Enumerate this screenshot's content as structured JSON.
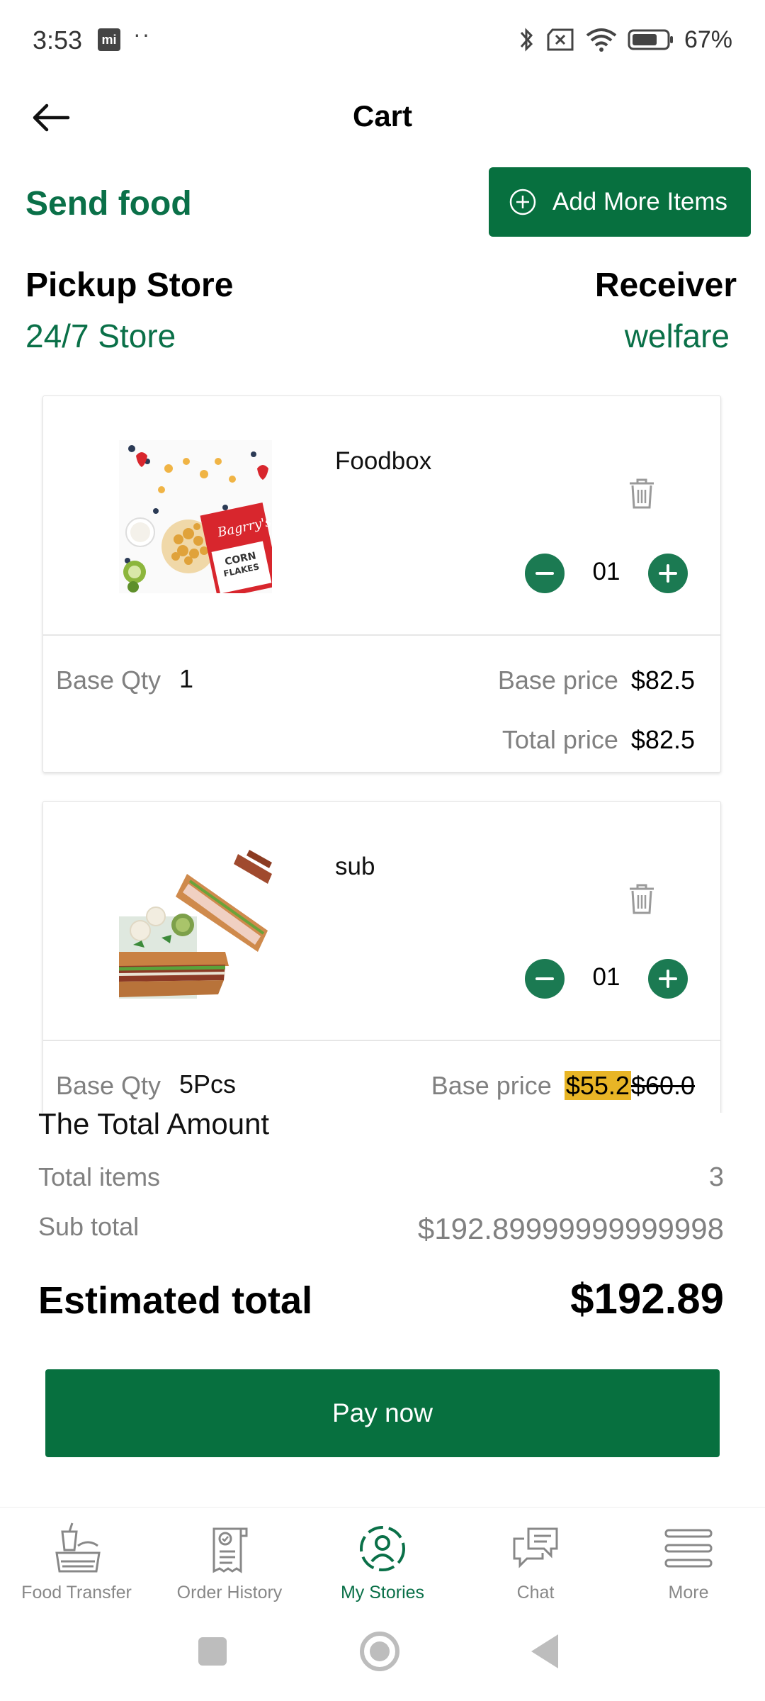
{
  "status_bar": {
    "time": "3:53",
    "mi_badge": "mi",
    "dots": "··",
    "battery": "67%",
    "icons": [
      "bluetooth-icon",
      "no-sim-icon",
      "wifi-icon",
      "battery-icon"
    ]
  },
  "app_bar": {
    "title": "Cart",
    "back_icon": "back-arrow-icon"
  },
  "send_food": {
    "title": "Send food",
    "add_more_label": "Add More Items",
    "add_more_icon": "plus-circle-icon"
  },
  "pickup": {
    "title": "Pickup Store",
    "value": "24/7 Store"
  },
  "receiver": {
    "title": "Receiver",
    "value": "welfare"
  },
  "items": [
    {
      "name": "Foodbox",
      "qty": "01",
      "base_qty_label": "Base Qty",
      "base_qty": "1",
      "base_price_label": "Base price",
      "base_price": "$82.5",
      "total_price_label": "Total price",
      "total_price": "$82.5"
    },
    {
      "name": "sub",
      "qty": "01",
      "base_qty_label": "Base Qty",
      "base_qty": "5Pcs",
      "base_price_label": "Base price",
      "discount_price": "$55.2",
      "original_price": "$60.0"
    }
  ],
  "summary": {
    "title": "The Total Amount",
    "total_items_label": "Total items",
    "total_items": "3",
    "subtotal_label": "Sub total",
    "subtotal": "$192.89999999999998",
    "estimated_label": "Estimated total",
    "estimated": "$192.89"
  },
  "pay_button": "Pay now",
  "bottom_nav": [
    {
      "label": "Food Transfer",
      "icon": "food-transfer-icon"
    },
    {
      "label": "Order History",
      "icon": "order-history-icon"
    },
    {
      "label": "My Stories",
      "icon": "my-stories-icon",
      "active": true
    },
    {
      "label": "Chat",
      "icon": "chat-icon"
    },
    {
      "label": "More",
      "icon": "menu-icon"
    }
  ],
  "colors": {
    "brand_green": "#07703f",
    "text_green": "#0a7048",
    "discount_highlight": "#e8b526",
    "muted_text": "#808080"
  }
}
